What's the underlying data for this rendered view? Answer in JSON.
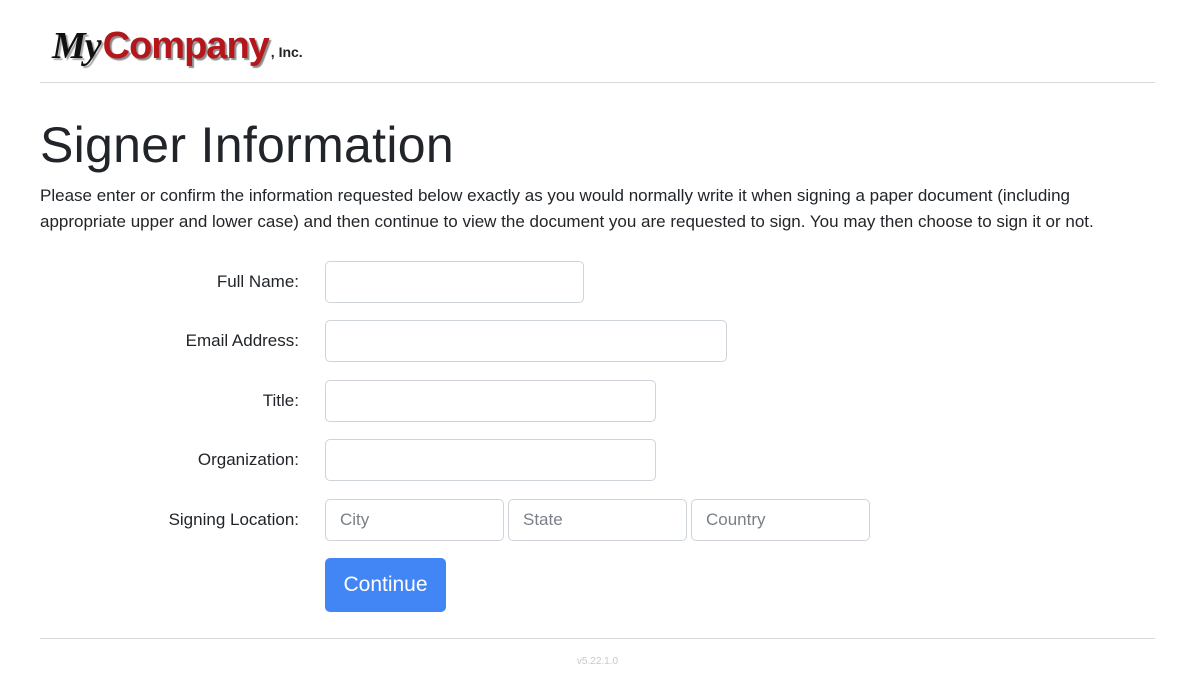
{
  "logo": {
    "my": "My",
    "company": "Company",
    "inc": ", Inc."
  },
  "page_title": "Signer Information",
  "intro_text": "Please enter or confirm the information requested below exactly as you would normally write it when signing a paper document (including appropriate upper and lower case) and then continue to view the document you are requested to sign. You may then choose to sign it or not.",
  "form": {
    "full_name": {
      "label": "Full Name:",
      "value": ""
    },
    "email": {
      "label": "Email Address:",
      "value": ""
    },
    "title": {
      "label": "Title:",
      "value": ""
    },
    "organization": {
      "label": "Organization:",
      "value": ""
    },
    "signing_location": {
      "label": "Signing Location:",
      "city_placeholder": "City",
      "state_placeholder": "State",
      "country_placeholder": "Country"
    },
    "continue_label": "Continue"
  },
  "version": "v5.22.1.0",
  "colors": {
    "brand_red": "#b5161b",
    "button_blue": "#4285f4"
  }
}
